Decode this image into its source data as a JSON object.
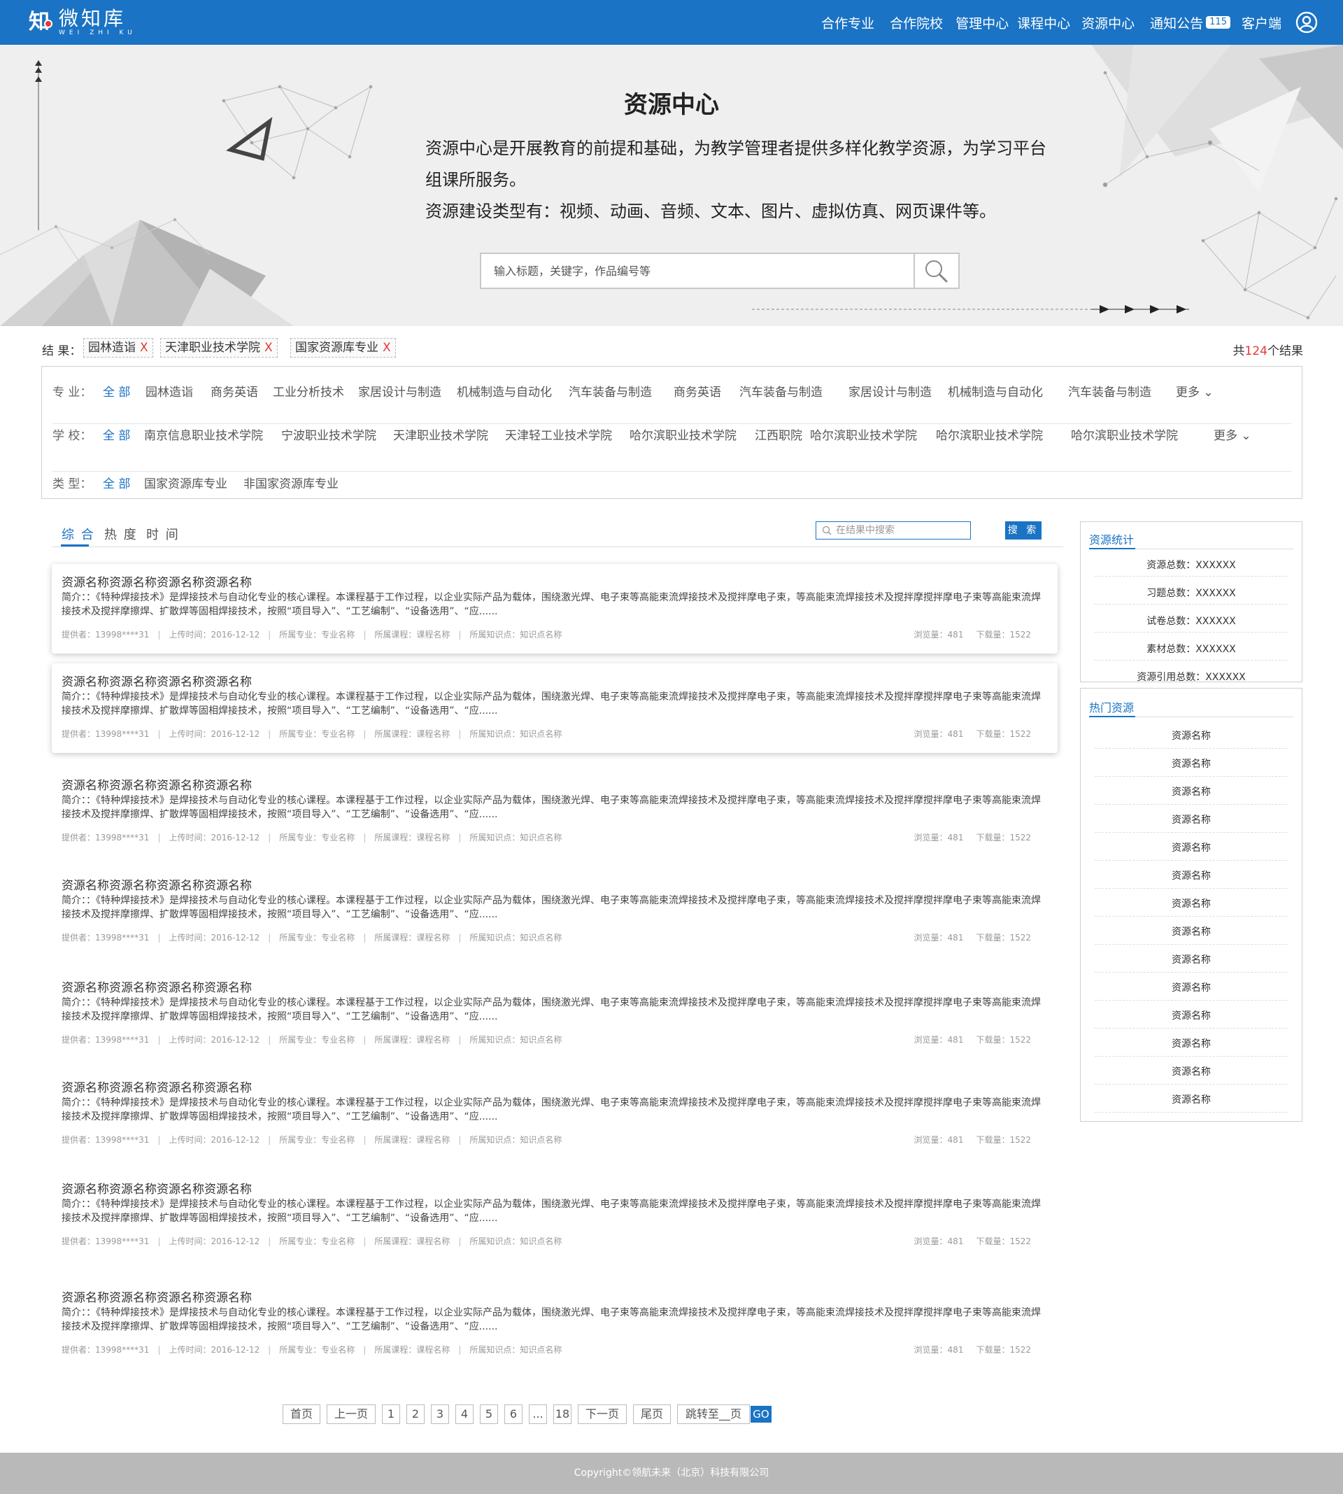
{
  "header": {
    "logo_zh": "微知库",
    "logo_en": "WEI ZHI KU",
    "logo_glyph": "知",
    "nav": [
      "合作专业",
      "合作院校",
      "管理中心",
      "课程中心",
      "资源中心",
      "通知公告",
      "客户端"
    ],
    "notice_badge": "115",
    "icons": {
      "user": "user-circle-icon"
    }
  },
  "banner": {
    "title": "资源中心",
    "desc_line1": "资源中心是开展教育的前提和基础，为教学管理者提供多样化教学资源，为学习平台",
    "desc_line2": "组课所服务。",
    "desc_line3": "资源建设类型有：视频、动画、音频、文本、图片、虚拟仿真、网页课件等。",
    "search_placeholder": "输入标题，关键字，作品编号等"
  },
  "results": {
    "label": "结 果：",
    "chips": [
      "园林造诣",
      "天津职业技术学院",
      "国家资源库专业"
    ],
    "chip_close": "X",
    "total_prefix": "共",
    "total_count": "124",
    "total_suffix": "个结果"
  },
  "filters": {
    "major": {
      "label": "专 业：",
      "items": [
        "全 部",
        "园林造诣",
        "商务英语",
        "工业分析技术",
        "家居设计与制造",
        "机械制造与自动化",
        "汽车装备与制造",
        "商务英语",
        "汽车装备与制造",
        "家居设计与制造",
        "机械制造与自动化",
        "汽车装备与制造"
      ],
      "more": "更多"
    },
    "school": {
      "label": "学 校：",
      "items": [
        "全 部",
        "南京信息职业技术学院",
        "宁波职业技术学院",
        "天津职业技术学院",
        "天津轻工业技术学院",
        "哈尔滨职业技术学院",
        "江西职院",
        "哈尔滨职业技术学院",
        "哈尔滨职业技术学院",
        "哈尔滨职业技术学院"
      ],
      "more": "更多"
    },
    "type": {
      "label": "类 型：",
      "items": [
        "全 部",
        "国家资源库专业",
        "非国家资源库专业"
      ]
    }
  },
  "sort": {
    "tabs": [
      "综 合",
      "热 度",
      "时 间"
    ],
    "active": 0,
    "search_placeholder": "在结果中搜索",
    "search_button": "搜 索"
  },
  "cards": [
    {
      "title": "资源名称资源名称资源名称资源名称",
      "desc": "简介：：《特种焊接技术》是焊接技术与自动化专业的核心课程。本课程基于工作过程，以企业实际产品为载体，围绕激光焊、电子束等高能束流焊接技术及搅拌摩电子束，等高能束流焊接技术及搅拌摩搅拌摩电子束等高能束流焊接技术及搅拌摩擦焊、扩散焊等固相焊接技术，按照“项目导入”、“工艺编制”、“设备选用”、“应......",
      "provider": "提供者：13998****31",
      "upload": "上传时间：2016-12-12",
      "major": "所属专业：专业名称",
      "course": "所属课程：课程名称",
      "point": "所属知识点：知识点名称",
      "views": "浏览量：481",
      "downloads": "下载量：1522",
      "shadow": true
    },
    {
      "title": "资源名称资源名称资源名称资源名称",
      "desc": "简介：：《特种焊接技术》是焊接技术与自动化专业的核心课程。本课程基于工作过程，以企业实际产品为载体，围绕激光焊、电子束等高能束流焊接技术及搅拌摩电子束，等高能束流焊接技术及搅拌摩搅拌摩电子束等高能束流焊接技术及搅拌摩擦焊、扩散焊等固相焊接技术，按照“项目导入”、“工艺编制”、“设备选用”、“应......",
      "provider": "提供者：13998****31",
      "upload": "上传时间：2016-12-12",
      "major": "所属专业：专业名称",
      "course": "所属课程：课程名称",
      "point": "所属知识点：知识点名称",
      "views": "浏览量：481",
      "downloads": "下载量：1522",
      "shadow": true
    },
    {
      "title": "资源名称资源名称资源名称资源名称",
      "desc": "简介：：《特种焊接技术》是焊接技术与自动化专业的核心课程。本课程基于工作过程，以企业实际产品为载体，围绕激光焊、电子束等高能束流焊接技术及搅拌摩电子束，等高能束流焊接技术及搅拌摩搅拌摩电子束等高能束流焊接技术及搅拌摩擦焊、扩散焊等固相焊接技术，按照“项目导入”、“工艺编制”、“设备选用”、“应......",
      "provider": "提供者：13998****31",
      "upload": "上传时间：2016-12-12",
      "major": "所属专业：专业名称",
      "course": "所属课程：课程名称",
      "point": "所属知识点：知识点名称",
      "views": "浏览量：481",
      "downloads": "下载量：1522",
      "shadow": false
    },
    {
      "title": "资源名称资源名称资源名称资源名称",
      "desc": "简介：：《特种焊接技术》是焊接技术与自动化专业的核心课程。本课程基于工作过程，以企业实际产品为载体，围绕激光焊、电子束等高能束流焊接技术及搅拌摩电子束，等高能束流焊接技术及搅拌摩搅拌摩电子束等高能束流焊接技术及搅拌摩擦焊、扩散焊等固相焊接技术，按照“项目导入”、“工艺编制”、“设备选用”、“应......",
      "provider": "提供者：13998****31",
      "upload": "上传时间：2016-12-12",
      "major": "所属专业：专业名称",
      "course": "所属课程：课程名称",
      "point": "所属知识点：知识点名称",
      "views": "浏览量：481",
      "downloads": "下载量：1522",
      "shadow": false
    },
    {
      "title": "资源名称资源名称资源名称资源名称",
      "desc": "简介：：《特种焊接技术》是焊接技术与自动化专业的核心课程。本课程基于工作过程，以企业实际产品为载体，围绕激光焊、电子束等高能束流焊接技术及搅拌摩电子束，等高能束流焊接技术及搅拌摩搅拌摩电子束等高能束流焊接技术及搅拌摩擦焊、扩散焊等固相焊接技术，按照“项目导入”、“工艺编制”、“设备选用”、“应......",
      "provider": "提供者：13998****31",
      "upload": "上传时间：2016-12-12",
      "major": "所属专业：专业名称",
      "course": "所属课程：课程名称",
      "point": "所属知识点：知识点名称",
      "views": "浏览量：481",
      "downloads": "下载量：1522",
      "shadow": false
    },
    {
      "title": "资源名称资源名称资源名称资源名称",
      "desc": "简介：：《特种焊接技术》是焊接技术与自动化专业的核心课程。本课程基于工作过程，以企业实际产品为载体，围绕激光焊、电子束等高能束流焊接技术及搅拌摩电子束，等高能束流焊接技术及搅拌摩搅拌摩电子束等高能束流焊接技术及搅拌摩擦焊、扩散焊等固相焊接技术，按照“项目导入”、“工艺编制”、“设备选用”、“应......",
      "provider": "提供者：13998****31",
      "upload": "上传时间：2016-12-12",
      "major": "所属专业：专业名称",
      "course": "所属课程：课程名称",
      "point": "所属知识点：知识点名称",
      "views": "浏览量：481",
      "downloads": "下载量：1522",
      "shadow": false
    },
    {
      "title": "资源名称资源名称资源名称资源名称",
      "desc": "简介：：《特种焊接技术》是焊接技术与自动化专业的核心课程。本课程基于工作过程，以企业实际产品为载体，围绕激光焊、电子束等高能束流焊接技术及搅拌摩电子束，等高能束流焊接技术及搅拌摩搅拌摩电子束等高能束流焊接技术及搅拌摩擦焊、扩散焊等固相焊接技术，按照“项目导入”、“工艺编制”、“设备选用”、“应......",
      "provider": "提供者：13998****31",
      "upload": "上传时间：2016-12-12",
      "major": "所属专业：专业名称",
      "course": "所属课程：课程名称",
      "point": "所属知识点：知识点名称",
      "views": "浏览量：481",
      "downloads": "下载量：1522",
      "shadow": false
    },
    {
      "title": "资源名称资源名称资源名称资源名称",
      "desc": "简介：：《特种焊接技术》是焊接技术与自动化专业的核心课程。本课程基于工作过程，以企业实际产品为载体，围绕激光焊、电子束等高能束流焊接技术及搅拌摩电子束，等高能束流焊接技术及搅拌摩搅拌摩电子束等高能束流焊接技术及搅拌摩擦焊、扩散焊等固相焊接技术，按照“项目导入”、“工艺编制”、“设备选用”、“应......",
      "provider": "提供者：13998****31",
      "upload": "上传时间：2016-12-12",
      "major": "所属专业：专业名称",
      "course": "所属课程：课程名称",
      "point": "所属知识点：知识点名称",
      "views": "浏览量：481",
      "downloads": "下载量：1522",
      "shadow": false
    }
  ],
  "stats": {
    "title": "资源统计",
    "rows": [
      "资源总数：XXXXXX",
      "习题总数：XXXXXX",
      "试卷总数：XXXXXX",
      "素材总数：XXXXXX",
      "资源引用总数：XXXXXX"
    ]
  },
  "hot": {
    "title": "热门资源",
    "rows": [
      "资源名称",
      "资源名称",
      "资源名称",
      "资源名称",
      "资源名称",
      "资源名称",
      "资源名称",
      "资源名称",
      "资源名称",
      "资源名称",
      "资源名称",
      "资源名称",
      "资源名称",
      "资源名称"
    ]
  },
  "pagination": {
    "first": "首页",
    "prev": "上一页",
    "pages": [
      "1",
      "2",
      "3",
      "4",
      "5",
      "6",
      "...",
      "18"
    ],
    "next": "下一页",
    "last": "尾页",
    "jump": "跳转至__页",
    "go": "GO"
  },
  "footer": {
    "copyright": "Copyright©领航未来（北京）科技有限公司"
  },
  "colors": {
    "brand": "#1a73c4",
    "accent_red": "#e53935",
    "banner_bg": "#efefef",
    "footer_bg": "#b9b9b9"
  }
}
